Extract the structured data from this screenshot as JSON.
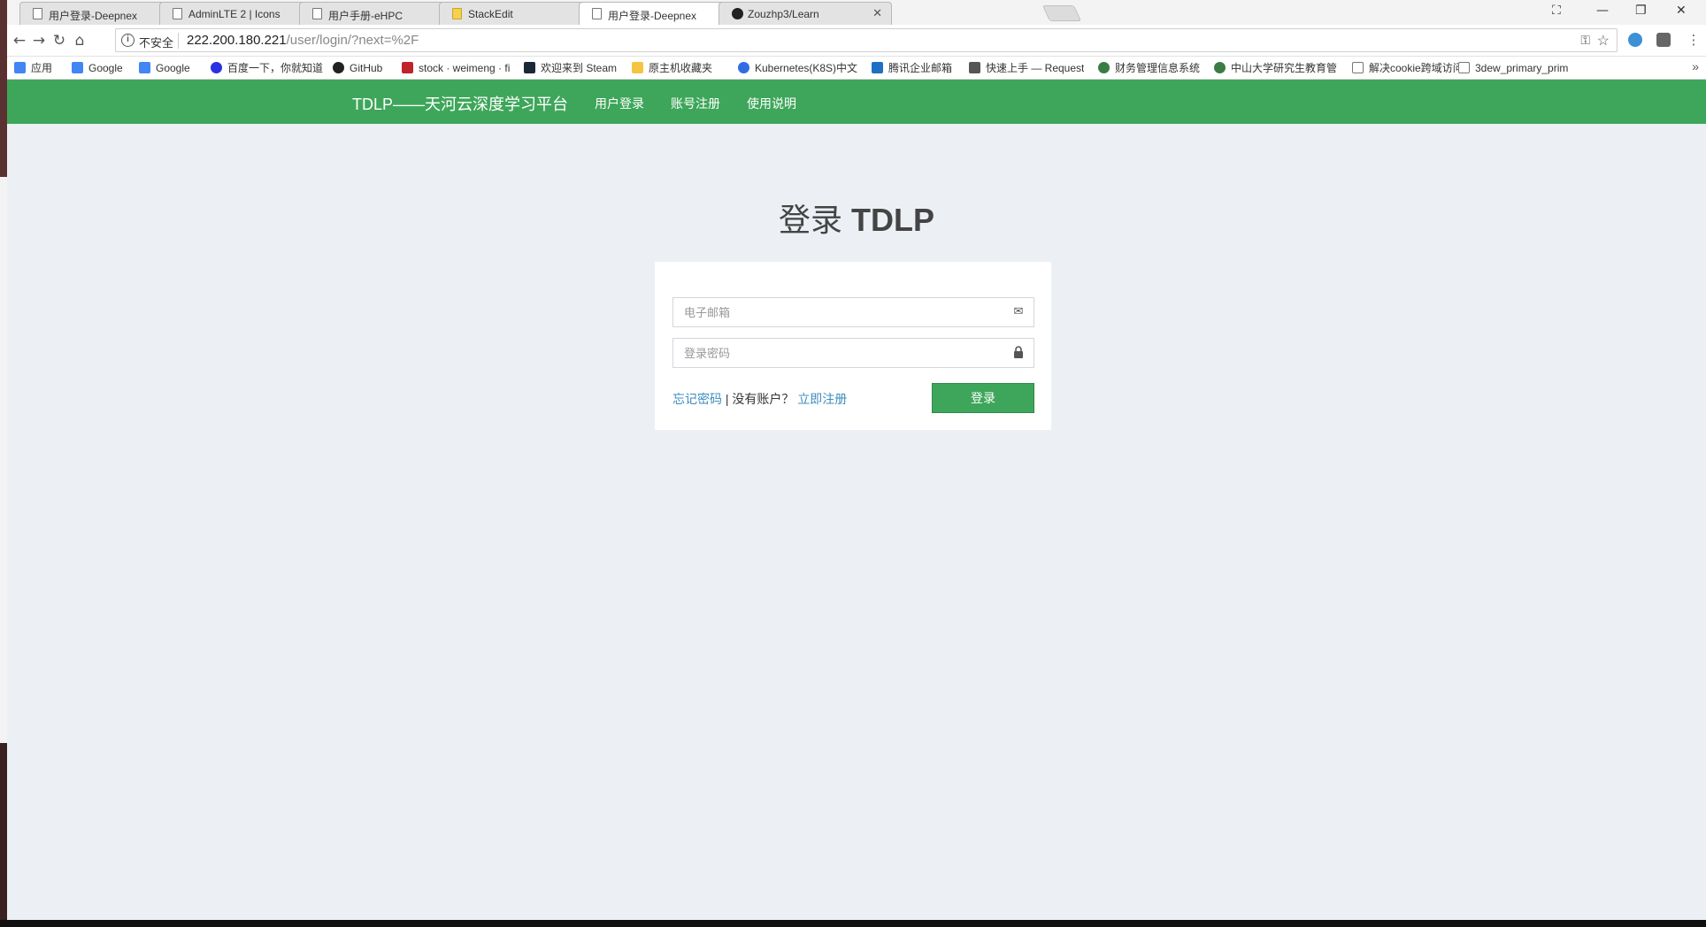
{
  "tabs": [
    {
      "label": "用户登录-Deepnex",
      "fav": "page-icon"
    },
    {
      "label": "AdminLTE 2 | Icons",
      "fav": "page-icon"
    },
    {
      "label": "用户手册-eHPC",
      "fav": "page-icon"
    },
    {
      "label": "StackEdit",
      "fav": "stackedit-icon"
    },
    {
      "label": "用户登录-Deepnex",
      "fav": "page-icon",
      "active": true
    },
    {
      "label": "Zouzhp3/Learn",
      "fav": "github-icon"
    }
  ],
  "omnibox": {
    "security": "不安全",
    "host": "222.200.180.221",
    "path": "/user/login/?next=%2F"
  },
  "bookmarks": [
    {
      "label": "应用",
      "icon": "apps-icon",
      "color": "#4285f4"
    },
    {
      "label": "Google",
      "icon": "google-icon",
      "color": "#4285f4"
    },
    {
      "label": "Google",
      "icon": "google-icon",
      "color": "#4285f4"
    },
    {
      "label": "百度一下，你就知道",
      "icon": "baidu-icon",
      "color": "#2932e1"
    },
    {
      "label": "GitHub",
      "icon": "github-icon",
      "color": "#222222"
    },
    {
      "label": "stock · weimeng · fi",
      "icon": "stock-icon",
      "color": "#c0242b"
    },
    {
      "label": "欢迎来到 Steam",
      "icon": "steam-icon",
      "color": "#1b2838"
    },
    {
      "label": "原主机收藏夹",
      "icon": "folder-icon",
      "color": "#f5c542"
    },
    {
      "label": "Kubernetes(K8S)中文",
      "icon": "kubernetes-icon",
      "color": "#326ce5"
    },
    {
      "label": "腾讯企业邮箱",
      "icon": "mail-icon",
      "color": "#1f6fc5"
    },
    {
      "label": "快速上手 — Request",
      "icon": "book-icon",
      "color": "#555555"
    },
    {
      "label": "财务管理信息系统",
      "icon": "seal-icon",
      "color": "#3a7d44"
    },
    {
      "label": "中山大学研究生教育管",
      "icon": "seal-icon",
      "color": "#3a7d44"
    },
    {
      "label": "解决cookie跨域访问",
      "icon": "page-icon",
      "color": "#777777"
    },
    {
      "label": "3dew_primary_prim",
      "icon": "page-icon",
      "color": "#777777"
    }
  ],
  "nav": {
    "brand": "TDLP——天河云深度学习平台",
    "links": [
      "用户登录",
      "账号注册",
      "使用说明"
    ]
  },
  "login": {
    "title_prefix": "登录",
    "title_brand": "TDLP",
    "email_placeholder": "电子邮箱",
    "password_placeholder": "登录密码",
    "forgot": "忘记密码",
    "separator": "| 没有账户？",
    "register": "立即注册",
    "submit": "登录"
  }
}
